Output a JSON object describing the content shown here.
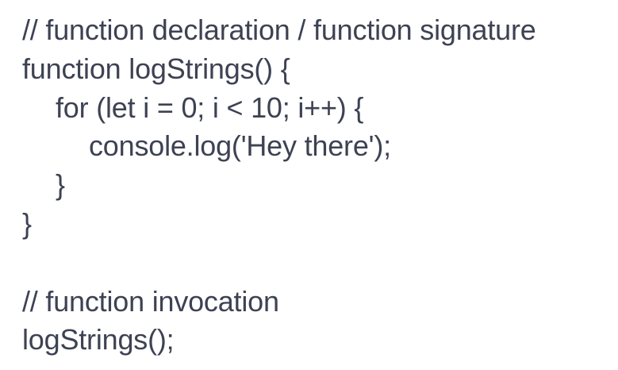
{
  "code": {
    "comment_declaration": "// function declaration / function signature",
    "line_function_header": "function logStrings() {",
    "line_for_loop": "for (let i = 0; i < 10; i++) {",
    "line_console_log": "console.log('Hey there');",
    "line_inner_close": "}",
    "line_outer_close": "}",
    "comment_invocation": "// function invocation",
    "line_invocation": "logStrings();"
  }
}
